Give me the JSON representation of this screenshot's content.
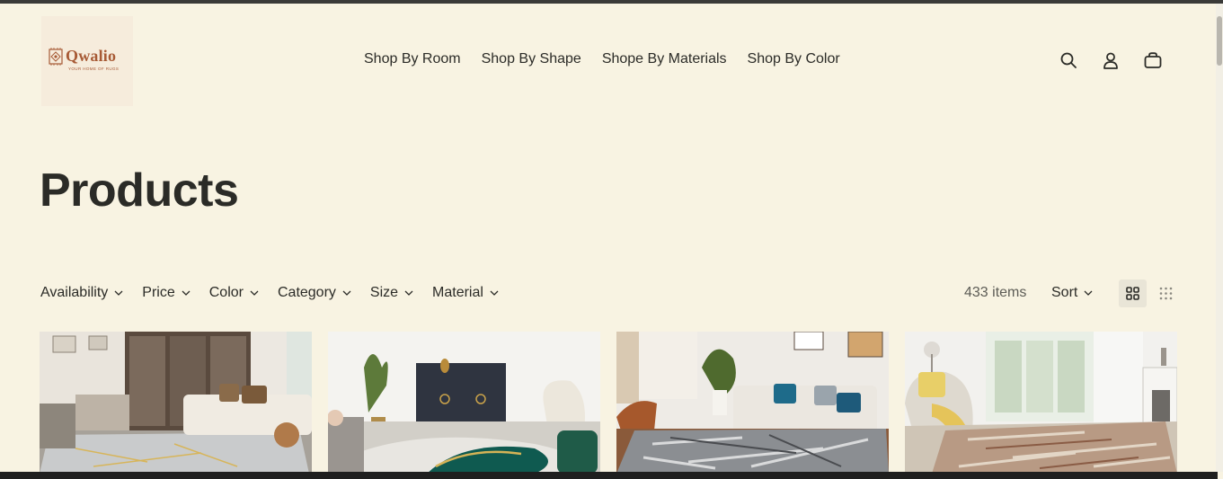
{
  "brand": {
    "name": "Qwalio",
    "tagline": "YOUR HOME OF RUGS"
  },
  "nav": {
    "items": [
      {
        "label": "Shop By Room"
      },
      {
        "label": "Shop By Shape"
      },
      {
        "label": "Shope By Materials"
      },
      {
        "label": "Shop By Color"
      }
    ]
  },
  "header_icons": [
    "search-icon",
    "account-icon",
    "cart-icon"
  ],
  "page": {
    "title": "Products"
  },
  "filters": [
    {
      "label": "Availability"
    },
    {
      "label": "Price"
    },
    {
      "label": "Color"
    },
    {
      "label": "Category"
    },
    {
      "label": "Size"
    },
    {
      "label": "Material"
    }
  ],
  "results": {
    "count": "433 items",
    "sort_label": "Sort"
  },
  "products": [
    {
      "image": "living-room-grey-gold-rug"
    },
    {
      "image": "living-room-green-gold-marble-rug"
    },
    {
      "image": "living-room-grey-abstract-rug"
    },
    {
      "image": "living-room-beige-distressed-rug"
    }
  ],
  "colors": {
    "background": "#f8f3e2",
    "brand": "#a75a35",
    "text": "#2b2b27"
  }
}
